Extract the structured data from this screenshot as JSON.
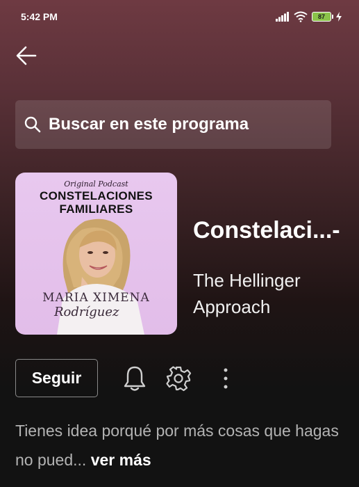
{
  "status_bar": {
    "time": "5:42 PM",
    "battery": "87",
    "icons": [
      "signal-icon",
      "wifi-icon",
      "battery-icon",
      "charging-icon"
    ]
  },
  "nav": {
    "back_icon": "arrow-left-icon"
  },
  "search": {
    "label": "Buscar en este programa",
    "icon": "search-icon"
  },
  "podcast": {
    "cover": {
      "subtitle": "Original Podcast",
      "title_line1": "CONSTELACIONES",
      "title_line2": "FAMILIARES",
      "author": "MARIA XIMENA",
      "signature": "Rodríguez"
    },
    "title": "Constelaci...-",
    "publisher": "The Hellinger Approach"
  },
  "actions": {
    "follow_label": "Seguir",
    "bell_icon": "bell-icon",
    "settings_icon": "gear-icon",
    "more_icon": "more-vertical-icon"
  },
  "description": {
    "text": "Tienes idea porqué por más cosas que hagas no pued... ",
    "see_more": "ver más"
  },
  "colors": {
    "background_top": "#6e3a42",
    "background_bottom": "#121212",
    "cover_bg": "#e5c3ec",
    "battery": "#8bc34a",
    "muted_text": "#b3b3b3"
  }
}
